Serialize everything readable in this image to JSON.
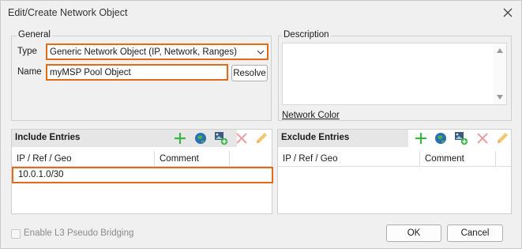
{
  "window": {
    "title": "Edit/Create Network Object"
  },
  "general": {
    "group_label": "General",
    "type_label": "Type",
    "type_value": "Generic Network Object (IP, Network, Ranges)",
    "name_label": "Name",
    "name_value": "myMSP Pool Object",
    "resolve_label": "Resolve"
  },
  "description": {
    "group_label": "Description",
    "value": "",
    "network_color_label": "Network Color"
  },
  "include": {
    "title": "Include Entries",
    "columns": [
      "IP / Ref / Geo",
      "Comment"
    ],
    "rows": [
      "10.0.1.0/30"
    ]
  },
  "exclude": {
    "title": "Exclude Entries",
    "columns": [
      "IP / Ref / Geo",
      "Comment"
    ]
  },
  "footer": {
    "bridging_label": "Enable L3 Pseudo Bridging",
    "ok_label": "OK",
    "cancel_label": "Cancel"
  },
  "colors": {
    "highlight": "#e06c1a",
    "add": "#3bb54a",
    "delete": "#e05050",
    "edit": "#f0b040"
  },
  "icons": [
    "close-icon",
    "chevron-down-icon",
    "add-icon",
    "globe-icon",
    "add-reference-icon",
    "delete-icon",
    "edit-icon",
    "scroll-up-icon",
    "scroll-down-icon"
  ]
}
